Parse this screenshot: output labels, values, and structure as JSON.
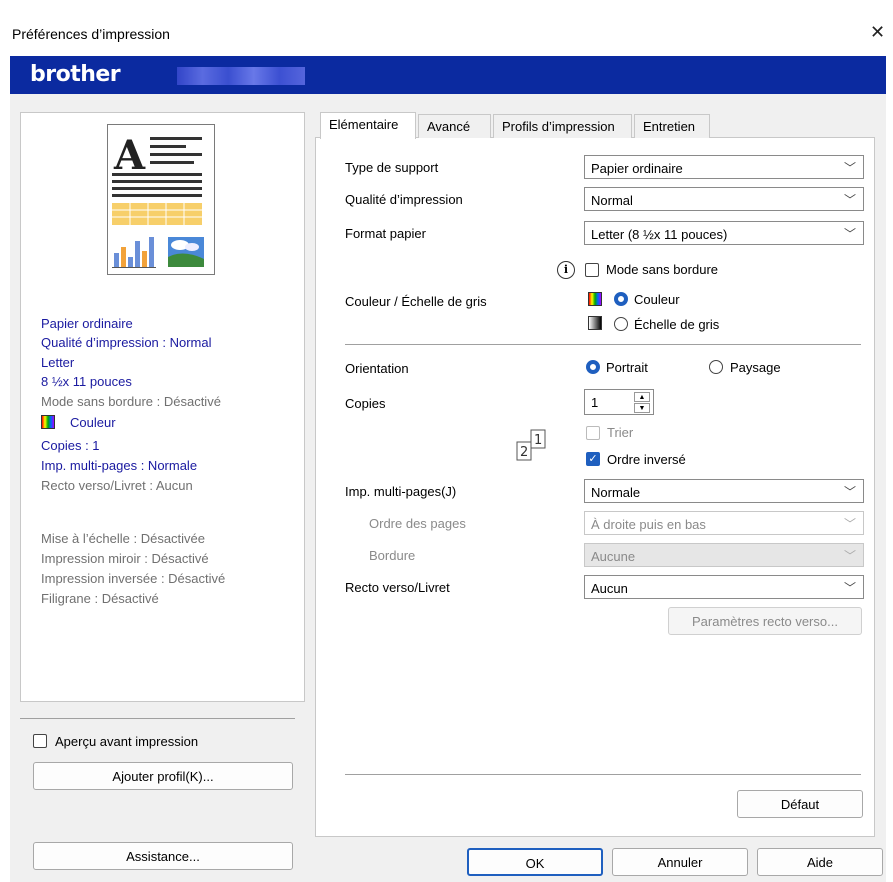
{
  "window": {
    "title": "Préférences d’impression",
    "close_glyph": "✕"
  },
  "brand": {
    "logo": "brother"
  },
  "tabs": [
    {
      "label": "Elémentaire"
    },
    {
      "label": "Avancé"
    },
    {
      "label": "Profils d’impression"
    },
    {
      "label": "Entretien"
    }
  ],
  "summary": {
    "media": "Papier ordinaire",
    "quality": "Qualité d’impression : Normal",
    "format": "Letter",
    "format_size": "8 ½x 11 pouces",
    "borderless": "Mode sans bordure : Désactivé",
    "color": "Couleur",
    "copies": "Copies : 1",
    "multipage": "Imp. multi-pages : Normale",
    "duplex": "Recto verso/Livret : Aucun",
    "scaling": "Mise à l’échelle : Désactivée",
    "mirror": "Impression miroir : Désactivé",
    "reverse": "Impression inversée : Désactivé",
    "watermark": "Filigrane : Désactivé"
  },
  "left": {
    "preview_checkbox": "Aperçu avant impression",
    "add_profile_button": "Ajouter profil(K)...",
    "support_button": "Assistance..."
  },
  "settings": {
    "media_label": "Type de support",
    "media_value": "Papier ordinaire",
    "quality_label": "Qualité d’impression",
    "quality_value": "Normal",
    "format_label": "Format papier",
    "format_value": "Letter (8 ½x 11 pouces)",
    "borderless_label": "Mode sans bordure",
    "color_label": "Couleur / Échelle de gris",
    "color_option": "Couleur",
    "gray_option": "Échelle de gris",
    "orientation_label": "Orientation",
    "portrait": "Portrait",
    "landscape": "Paysage",
    "copies_label": "Copies",
    "copies_value": "1",
    "collate": "Trier",
    "reverse_order": "Ordre inversé",
    "multipage_label": "Imp. multi-pages(J)",
    "multipage_value": "Normale",
    "page_order_label": "Ordre des pages",
    "page_order_value": "À droite puis en bas",
    "border_label": "Bordure",
    "border_value": "Aucune",
    "duplex_label": "Recto verso/Livret",
    "duplex_value": "Aucun",
    "duplex_settings_button": "Paramètres recto verso...",
    "default_button": "Défaut"
  },
  "footer": {
    "ok": "OK",
    "cancel": "Annuler",
    "help": "Aide"
  }
}
